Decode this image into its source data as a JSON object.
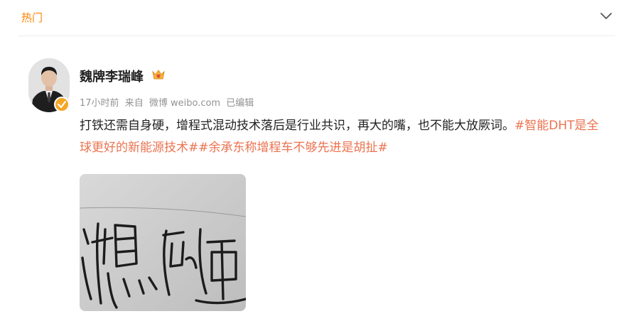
{
  "tabbar": {
    "hot_tab": "热门"
  },
  "post": {
    "author": "魏牌李瑞峰",
    "time": "17小时前",
    "source_prefix": "来自",
    "source": "微博 weibo.com",
    "edited": "已编辑",
    "text_main": "打铁还需自身硬，增程式混动技术落后是行业共识，再大的嘴，也不能大放厥词。",
    "hashtag_1": "#智能DHT是全球更好的新能源技术#",
    "hashtag_2": "#余承东称增程车不够先进是胡扯#"
  },
  "colors": {
    "accent": "#ff8200",
    "hashtag": "#eb7350",
    "meta": "#939393"
  },
  "icons": [
    "chevron-down-icon",
    "verified-icon",
    "vip-crown-icon"
  ]
}
